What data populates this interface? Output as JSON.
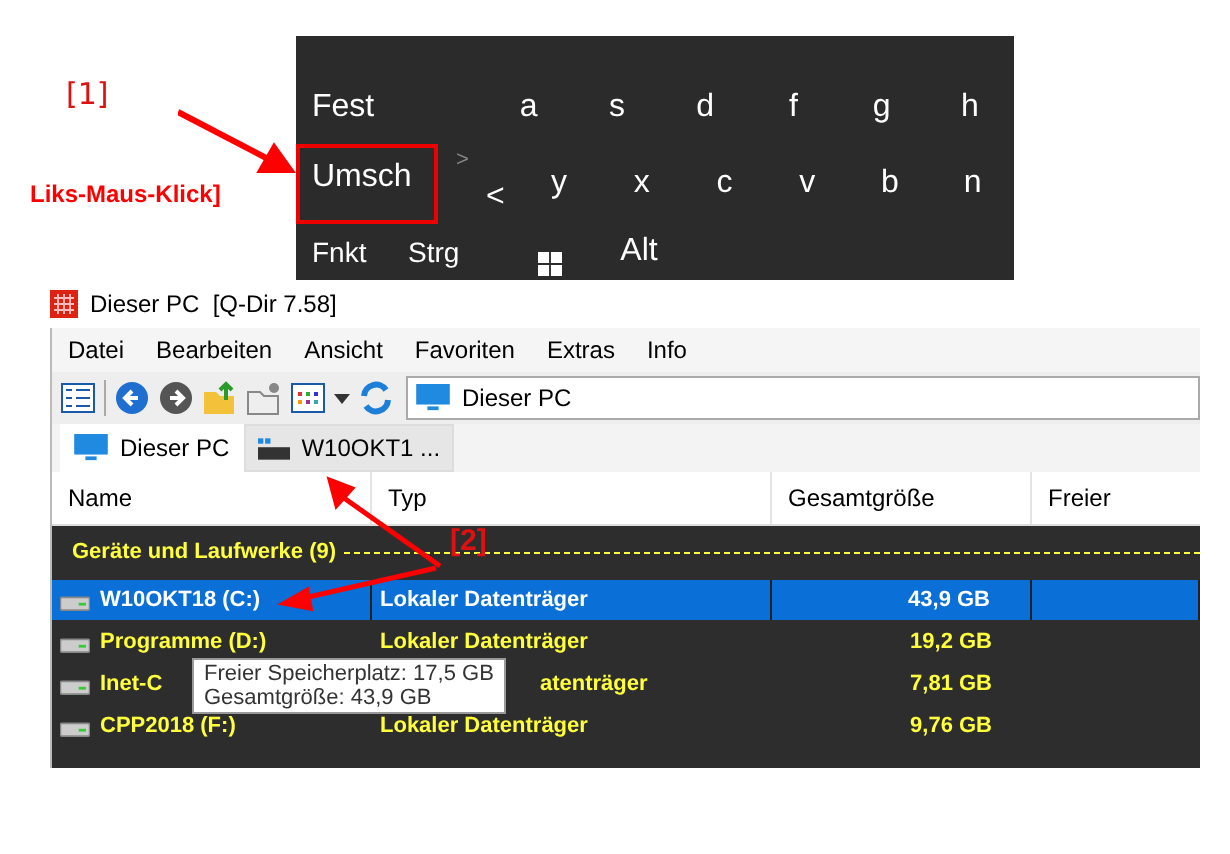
{
  "annotations": {
    "step_1": "[1]",
    "click_label": "Liks-Maus-Klick]",
    "step_2": "[2]"
  },
  "keyboard": {
    "shift_marker": ">",
    "angle_key": {
      "label": "<",
      "highlighted": false
    },
    "rows": [
      [
        {
          "label": "Fest",
          "kind": "wide",
          "highlighted": false
        },
        {
          "label": "a",
          "kind": "key",
          "highlighted": false
        },
        {
          "label": "s",
          "kind": "key",
          "highlighted": false
        },
        {
          "label": "d",
          "kind": "key",
          "highlighted": false
        },
        {
          "label": "f",
          "kind": "key",
          "highlighted": false
        },
        {
          "label": "g",
          "kind": "key",
          "highlighted": false
        },
        {
          "label": "h",
          "kind": "key",
          "highlighted": false
        }
      ],
      [
        {
          "label": "Umsch",
          "kind": "wide",
          "highlighted": true
        },
        {
          "label": "y",
          "kind": "key",
          "highlighted": false
        },
        {
          "label": "x",
          "kind": "key",
          "highlighted": false
        },
        {
          "label": "c",
          "kind": "key",
          "highlighted": false
        },
        {
          "label": "v",
          "kind": "key",
          "highlighted": false
        },
        {
          "label": "b",
          "kind": "key",
          "highlighted": false
        },
        {
          "label": "n",
          "kind": "key",
          "highlighted": false
        }
      ],
      [
        {
          "label": "Fnkt",
          "kind": "mod",
          "highlighted": false
        },
        {
          "label": "Strg",
          "kind": "mod",
          "highlighted": false
        },
        {
          "kind": "windows"
        },
        {
          "label": "Alt",
          "kind": "key",
          "highlighted": false
        }
      ]
    ]
  },
  "window": {
    "title": "Dieser PC  [Q-Dir 7.58]",
    "menu": [
      "Datei",
      "Bearbeiten",
      "Ansicht",
      "Favoriten",
      "Extras",
      "Info"
    ],
    "address": "Dieser PC",
    "tabs": [
      {
        "label": "Dieser PC",
        "selected": true
      },
      {
        "label": "W10OKT1 ...",
        "selected": false
      }
    ],
    "columns": [
      "Name",
      "Typ",
      "Gesamtgröße",
      "Freier"
    ],
    "group": "Geräte und Laufwerke (9)",
    "rows": [
      {
        "name": "W10OKT18 (C:)",
        "type": "Lokaler Datenträger",
        "size": "43,9 GB",
        "selected": true
      },
      {
        "name": "Programme (D:)",
        "type": "Lokaler Datenträger",
        "size": "19,2 GB",
        "selected": false
      },
      {
        "name": "Inet-C",
        "type": "atenträger",
        "size": "7,81 GB",
        "selected": false
      },
      {
        "name": "CPP2018 (F:)",
        "type": "Lokaler Datenträger",
        "size": "9,76 GB",
        "selected": false
      }
    ],
    "tooltip": [
      "Freier Speicherplatz: 17,5 GB",
      "Gesamtgröße: 43,9 GB"
    ]
  }
}
